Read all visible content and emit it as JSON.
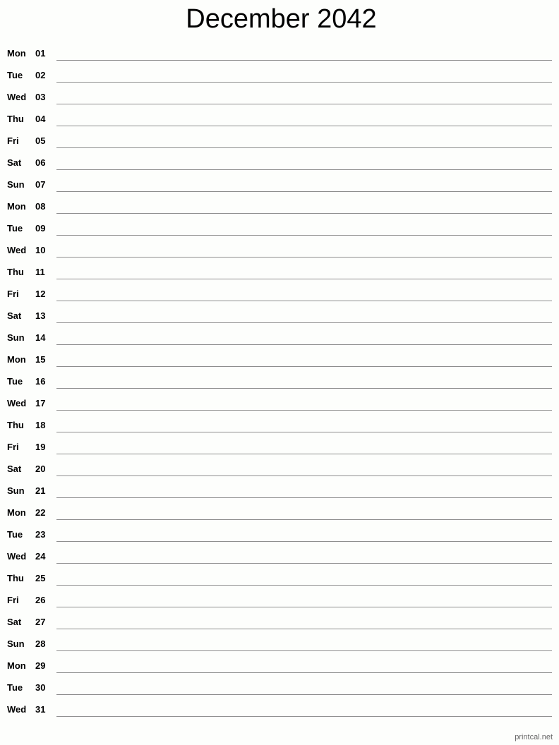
{
  "title": "December 2042",
  "days": [
    {
      "dow": "Mon",
      "num": "01"
    },
    {
      "dow": "Tue",
      "num": "02"
    },
    {
      "dow": "Wed",
      "num": "03"
    },
    {
      "dow": "Thu",
      "num": "04"
    },
    {
      "dow": "Fri",
      "num": "05"
    },
    {
      "dow": "Sat",
      "num": "06"
    },
    {
      "dow": "Sun",
      "num": "07"
    },
    {
      "dow": "Mon",
      "num": "08"
    },
    {
      "dow": "Tue",
      "num": "09"
    },
    {
      "dow": "Wed",
      "num": "10"
    },
    {
      "dow": "Thu",
      "num": "11"
    },
    {
      "dow": "Fri",
      "num": "12"
    },
    {
      "dow": "Sat",
      "num": "13"
    },
    {
      "dow": "Sun",
      "num": "14"
    },
    {
      "dow": "Mon",
      "num": "15"
    },
    {
      "dow": "Tue",
      "num": "16"
    },
    {
      "dow": "Wed",
      "num": "17"
    },
    {
      "dow": "Thu",
      "num": "18"
    },
    {
      "dow": "Fri",
      "num": "19"
    },
    {
      "dow": "Sat",
      "num": "20"
    },
    {
      "dow": "Sun",
      "num": "21"
    },
    {
      "dow": "Mon",
      "num": "22"
    },
    {
      "dow": "Tue",
      "num": "23"
    },
    {
      "dow": "Wed",
      "num": "24"
    },
    {
      "dow": "Thu",
      "num": "25"
    },
    {
      "dow": "Fri",
      "num": "26"
    },
    {
      "dow": "Sat",
      "num": "27"
    },
    {
      "dow": "Sun",
      "num": "28"
    },
    {
      "dow": "Mon",
      "num": "29"
    },
    {
      "dow": "Tue",
      "num": "30"
    },
    {
      "dow": "Wed",
      "num": "31"
    }
  ],
  "footer": "printcal.net"
}
